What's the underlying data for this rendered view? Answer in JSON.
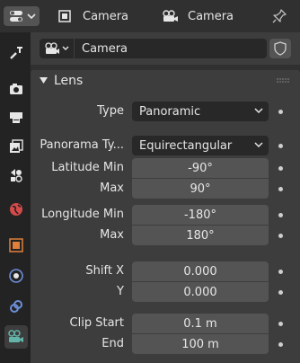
{
  "header": {
    "object_name": "Camera",
    "data_name": "Camera"
  },
  "datablock": {
    "name": "Camera"
  },
  "panel": {
    "title": "Lens",
    "rows": [
      {
        "label": "Type",
        "value": "Panoramic"
      },
      {
        "label": "Panorama Ty...",
        "value": "Equirectangular"
      },
      {
        "label": "Latitude Min",
        "value": "-90°"
      },
      {
        "label": "Max",
        "value": "90°"
      },
      {
        "label": "Longitude Min",
        "value": "-180°"
      },
      {
        "label": "Max",
        "value": "180°"
      },
      {
        "label": "Shift X",
        "value": "0.000"
      },
      {
        "label": "Y",
        "value": "0.000"
      },
      {
        "label": "Clip Start",
        "value": "0.1 m"
      },
      {
        "label": "End",
        "value": "100 m"
      }
    ]
  },
  "colors": {
    "accent_active": "#63b4a8",
    "object_orange": "#e0803b",
    "world_red": "#d24a4a",
    "constraint_blue": "#6c8ed8"
  }
}
